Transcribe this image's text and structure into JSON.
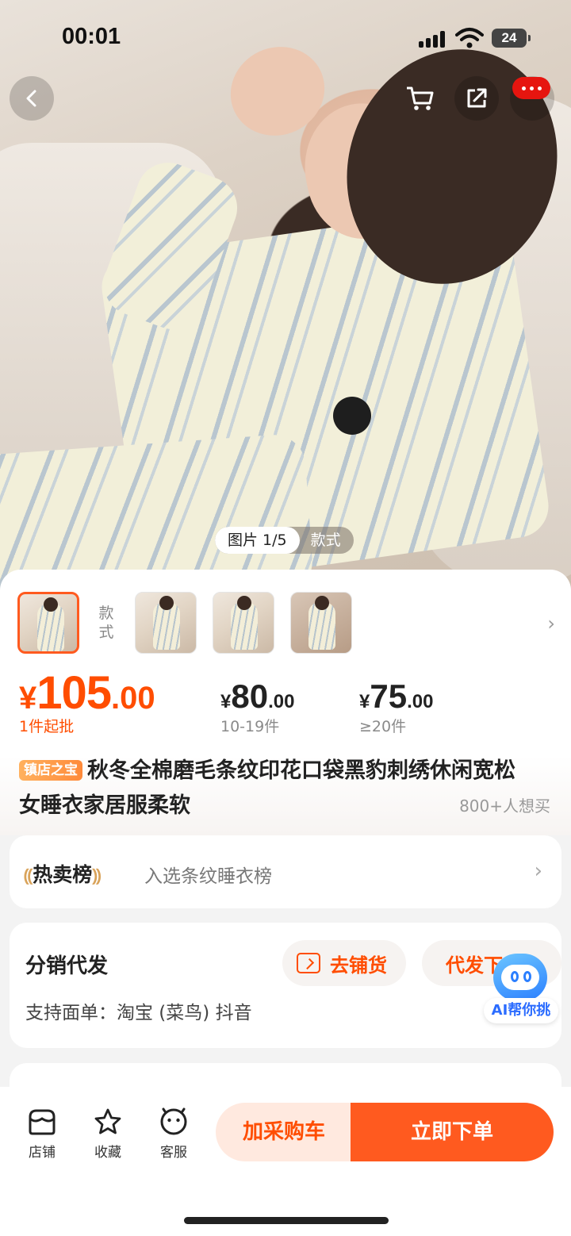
{
  "status_bar": {
    "time": "00:01",
    "battery": "24"
  },
  "hero": {
    "image_tab_active": "图片 1/5",
    "image_tab_other": "款式"
  },
  "thumbnails": {
    "style_label": "款式"
  },
  "prices": {
    "main": {
      "currency": "¥",
      "integer": "105",
      "decimal": ".00",
      "note": "1件起批"
    },
    "tiers": [
      {
        "currency": "¥",
        "integer": "80",
        "decimal": ".00",
        "range": "10-19件"
      },
      {
        "currency": "¥",
        "integer": "75",
        "decimal": ".00",
        "range": "≥20件"
      }
    ]
  },
  "product": {
    "badge": "镇店之宝",
    "title": "秋冬全棉磨毛条纹印花口袋黑豹刺绣休闲宽松女睡衣家居服柔软",
    "want_count": "800+人想买"
  },
  "hot_list": {
    "tag": "热卖榜",
    "text": "入选条纹睡衣榜"
  },
  "distribution": {
    "title": "分销代发",
    "store_button": "去铺货",
    "dropship_button": "代发下",
    "platforms": "支持面单：淘宝 (菜鸟) 抖音"
  },
  "ai_helper": {
    "label": "AI帮你挑"
  },
  "bottom_bar": {
    "shop": "店铺",
    "favorite": "收藏",
    "service": "客服",
    "add_to_cart": "加采购车",
    "buy_now": "立即下单"
  },
  "colors": {
    "accent": "#ff5a1f",
    "price": "#ff4d00",
    "cart_bg": "#ffe9df",
    "more_red": "#e6150f",
    "ai_blue": "#2b7fff"
  },
  "icons": [
    "back-icon",
    "cart-icon",
    "share-icon",
    "more-icon",
    "folder-arrow-icon",
    "store-icon",
    "star-icon",
    "chat-face-icon",
    "chevron-right-icon",
    "laurel-icon"
  ]
}
